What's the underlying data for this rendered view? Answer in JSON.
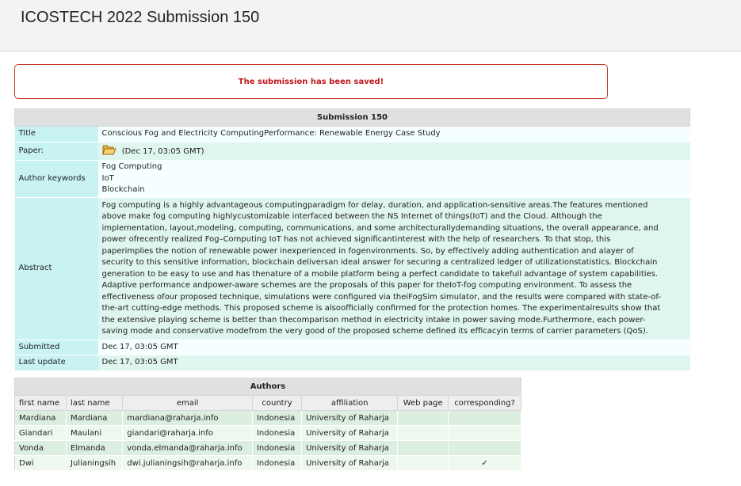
{
  "page": {
    "title": "ICOSTECH 2022 Submission 150"
  },
  "alert": {
    "message": "The submission has been saved!"
  },
  "submission": {
    "caption": "Submission 150",
    "title_label": "Title",
    "title": "Conscious Fog and Electricity ComputingPerformance: Renewable Energy Case Study",
    "paper_label": "Paper:",
    "paper_date": "(Dec 17, 03:05 GMT)",
    "keywords_label": "Author keywords",
    "keywords": [
      "Fog Computing",
      "IoT",
      "Blockchain"
    ],
    "abstract_label": "Abstract",
    "abstract_lines": [
      "Fog computing is a highly advantageous computingparadigm for delay, duration, and application-sensitive areas.The features mentioned",
      "above make fog computing highlycustomizable interfaced between the NS Internet of things(IoT) and the Cloud. Although the",
      "implementation, layout,modeling, computing, communications, and some architecturallydemanding situations, the overall appearance, and",
      "power ofrecently realized Fog–Computing IoT has not achieved significantinterest with the help of researchers. To that stop, this",
      "paperimplies the notion of renewable power inexperienced in fogenvironments. So, by effectively adding authentication and alayer of",
      "security to this sensitive information, blockchain deliversan ideal answer for securing a centralized ledger of utilizationstatistics. Blockchain",
      "generation to be easy to use and has thenature of a mobile platform being a perfect candidate to takefull advantage of system capabilities.",
      "Adaptive performance andpower-aware schemes are the proposals of this paper for theIoT-fog computing environment. To assess the",
      "effectiveness ofour proposed technique, simulations were configured via theiFogSim simulator, and the results were compared with state-of-",
      "the-art cutting-edge methods. This proposed scheme is alsoofficially confirmed for the protection homes. The experimentalresults show that",
      "the extensive playing scheme is better than thecomparison method in electricity intake in power saving mode.Furthermore, each power-",
      "saving mode and conservative modefrom the very good of the proposed scheme defined its efficacyin terms of carrier parameters (QoS)."
    ],
    "submitted_label": "Submitted",
    "submitted": "Dec 17, 03:05 GMT",
    "updated_label": "Last update",
    "updated": "Dec 17, 03:05 GMT"
  },
  "authors": {
    "caption": "Authors",
    "columns": [
      "first name",
      "last name",
      "email",
      "country",
      "affiliation",
      "Web page",
      "corresponding?"
    ],
    "rows": [
      {
        "first": "Mardiana",
        "last": "Mardiana",
        "email": "mardiana@raharja.info",
        "country": "Indonesia",
        "affiliation": "University of Raharja",
        "web": "",
        "corresponding": ""
      },
      {
        "first": "Giandari",
        "last": "Maulani",
        "email": "giandari@raharja.info",
        "country": "Indonesia",
        "affiliation": "University of Raharja",
        "web": "",
        "corresponding": ""
      },
      {
        "first": "Vonda",
        "last": "Elmanda",
        "email": "vonda.elmanda@raharja.info",
        "country": "Indonesia",
        "affiliation": "University of Raharja",
        "web": "",
        "corresponding": ""
      },
      {
        "first": "Dwi",
        "last": "Julianingsih",
        "email": "dwi.julianingsih@raharja.info",
        "country": "Indonesia",
        "affiliation": "University of Raharja",
        "web": "",
        "corresponding": "✓"
      }
    ]
  }
}
